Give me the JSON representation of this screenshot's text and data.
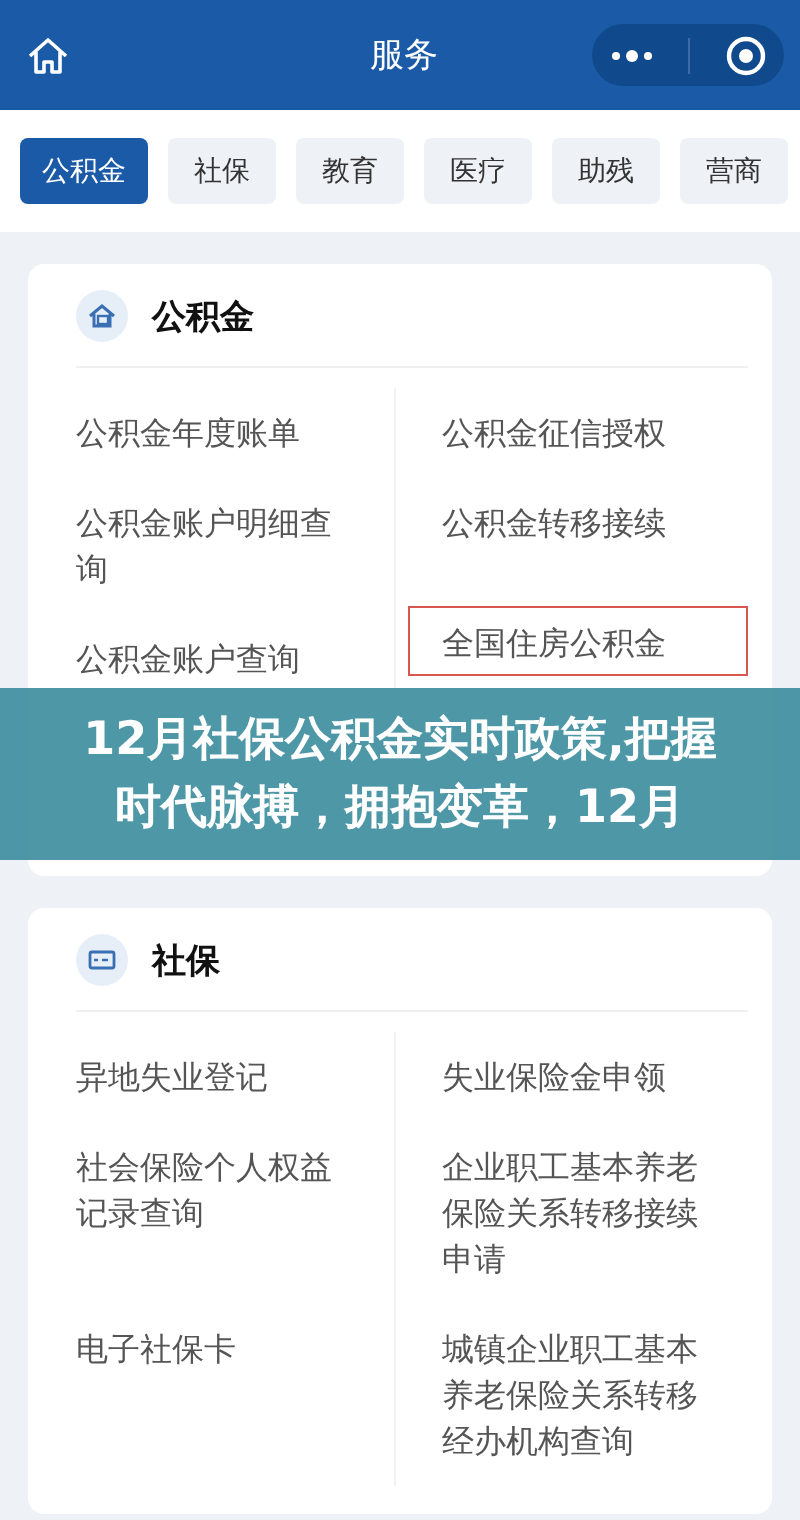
{
  "header": {
    "title": "服务"
  },
  "tabs": [
    {
      "label": "公积金",
      "selected": true
    },
    {
      "label": "社保",
      "selected": false
    },
    {
      "label": "教育",
      "selected": false
    },
    {
      "label": "医疗",
      "selected": false
    },
    {
      "label": "助残",
      "selected": false
    },
    {
      "label": "营商",
      "selected": false
    }
  ],
  "sections": [
    {
      "title": "公积金",
      "items": [
        {
          "label": "公积金年度账单",
          "highlighted": false
        },
        {
          "label": "公积金征信授权",
          "highlighted": false
        },
        {
          "label": "公积金账户明细查询",
          "highlighted": false
        },
        {
          "label": "公积金转移接续",
          "highlighted": false
        },
        {
          "label": "公积金账户查询",
          "highlighted": false
        },
        {
          "label": "全国住房公积金",
          "highlighted": true
        }
      ]
    },
    {
      "title": "社保",
      "items": [
        {
          "label": "异地失业登记",
          "highlighted": false
        },
        {
          "label": "失业保险金申领",
          "highlighted": false
        },
        {
          "label": "社会保险个人权益记录查询",
          "highlighted": false
        },
        {
          "label": "企业职工基本养老保险关系转移接续申请",
          "highlighted": false
        },
        {
          "label": "电子社保卡",
          "highlighted": false
        },
        {
          "label": "城镇企业职工基本养老保险关系转移经办机构查询",
          "highlighted": false
        }
      ]
    }
  ],
  "banner": {
    "text": "12月社保公积金实时政策,把握时代脉搏，拥抱变革，12月"
  }
}
